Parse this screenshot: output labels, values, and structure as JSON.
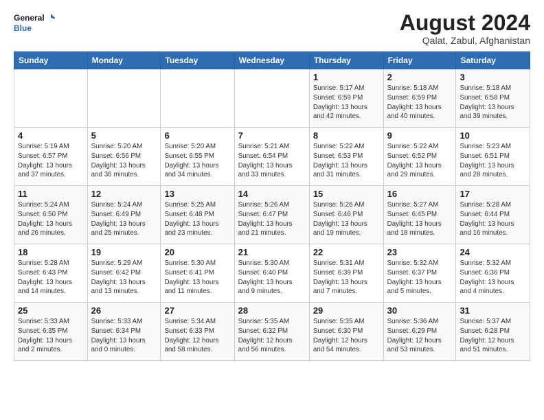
{
  "header": {
    "logo_line1": "General",
    "logo_line2": "Blue",
    "title": "August 2024",
    "subtitle": "Qalat, Zabul, Afghanistan"
  },
  "weekdays": [
    "Sunday",
    "Monday",
    "Tuesday",
    "Wednesday",
    "Thursday",
    "Friday",
    "Saturday"
  ],
  "weeks": [
    [
      {
        "day": "",
        "detail": ""
      },
      {
        "day": "",
        "detail": ""
      },
      {
        "day": "",
        "detail": ""
      },
      {
        "day": "",
        "detail": ""
      },
      {
        "day": "1",
        "detail": "Sunrise: 5:17 AM\nSunset: 6:59 PM\nDaylight: 13 hours\nand 42 minutes."
      },
      {
        "day": "2",
        "detail": "Sunrise: 5:18 AM\nSunset: 6:59 PM\nDaylight: 13 hours\nand 40 minutes."
      },
      {
        "day": "3",
        "detail": "Sunrise: 5:18 AM\nSunset: 6:58 PM\nDaylight: 13 hours\nand 39 minutes."
      }
    ],
    [
      {
        "day": "4",
        "detail": "Sunrise: 5:19 AM\nSunset: 6:57 PM\nDaylight: 13 hours\nand 37 minutes."
      },
      {
        "day": "5",
        "detail": "Sunrise: 5:20 AM\nSunset: 6:56 PM\nDaylight: 13 hours\nand 36 minutes."
      },
      {
        "day": "6",
        "detail": "Sunrise: 5:20 AM\nSunset: 6:55 PM\nDaylight: 13 hours\nand 34 minutes."
      },
      {
        "day": "7",
        "detail": "Sunrise: 5:21 AM\nSunset: 6:54 PM\nDaylight: 13 hours\nand 33 minutes."
      },
      {
        "day": "8",
        "detail": "Sunrise: 5:22 AM\nSunset: 6:53 PM\nDaylight: 13 hours\nand 31 minutes."
      },
      {
        "day": "9",
        "detail": "Sunrise: 5:22 AM\nSunset: 6:52 PM\nDaylight: 13 hours\nand 29 minutes."
      },
      {
        "day": "10",
        "detail": "Sunrise: 5:23 AM\nSunset: 6:51 PM\nDaylight: 13 hours\nand 28 minutes."
      }
    ],
    [
      {
        "day": "11",
        "detail": "Sunrise: 5:24 AM\nSunset: 6:50 PM\nDaylight: 13 hours\nand 26 minutes."
      },
      {
        "day": "12",
        "detail": "Sunrise: 5:24 AM\nSunset: 6:49 PM\nDaylight: 13 hours\nand 25 minutes."
      },
      {
        "day": "13",
        "detail": "Sunrise: 5:25 AM\nSunset: 6:48 PM\nDaylight: 13 hours\nand 23 minutes."
      },
      {
        "day": "14",
        "detail": "Sunrise: 5:26 AM\nSunset: 6:47 PM\nDaylight: 13 hours\nand 21 minutes."
      },
      {
        "day": "15",
        "detail": "Sunrise: 5:26 AM\nSunset: 6:46 PM\nDaylight: 13 hours\nand 19 minutes."
      },
      {
        "day": "16",
        "detail": "Sunrise: 5:27 AM\nSunset: 6:45 PM\nDaylight: 13 hours\nand 18 minutes."
      },
      {
        "day": "17",
        "detail": "Sunrise: 5:28 AM\nSunset: 6:44 PM\nDaylight: 13 hours\nand 16 minutes."
      }
    ],
    [
      {
        "day": "18",
        "detail": "Sunrise: 5:28 AM\nSunset: 6:43 PM\nDaylight: 13 hours\nand 14 minutes."
      },
      {
        "day": "19",
        "detail": "Sunrise: 5:29 AM\nSunset: 6:42 PM\nDaylight: 13 hours\nand 13 minutes."
      },
      {
        "day": "20",
        "detail": "Sunrise: 5:30 AM\nSunset: 6:41 PM\nDaylight: 13 hours\nand 11 minutes."
      },
      {
        "day": "21",
        "detail": "Sunrise: 5:30 AM\nSunset: 6:40 PM\nDaylight: 13 hours\nand 9 minutes."
      },
      {
        "day": "22",
        "detail": "Sunrise: 5:31 AM\nSunset: 6:39 PM\nDaylight: 13 hours\nand 7 minutes."
      },
      {
        "day": "23",
        "detail": "Sunrise: 5:32 AM\nSunset: 6:37 PM\nDaylight: 13 hours\nand 5 minutes."
      },
      {
        "day": "24",
        "detail": "Sunrise: 5:32 AM\nSunset: 6:36 PM\nDaylight: 13 hours\nand 4 minutes."
      }
    ],
    [
      {
        "day": "25",
        "detail": "Sunrise: 5:33 AM\nSunset: 6:35 PM\nDaylight: 13 hours\nand 2 minutes."
      },
      {
        "day": "26",
        "detail": "Sunrise: 5:33 AM\nSunset: 6:34 PM\nDaylight: 13 hours\nand 0 minutes."
      },
      {
        "day": "27",
        "detail": "Sunrise: 5:34 AM\nSunset: 6:33 PM\nDaylight: 12 hours\nand 58 minutes."
      },
      {
        "day": "28",
        "detail": "Sunrise: 5:35 AM\nSunset: 6:32 PM\nDaylight: 12 hours\nand 56 minutes."
      },
      {
        "day": "29",
        "detail": "Sunrise: 5:35 AM\nSunset: 6:30 PM\nDaylight: 12 hours\nand 54 minutes."
      },
      {
        "day": "30",
        "detail": "Sunrise: 5:36 AM\nSunset: 6:29 PM\nDaylight: 12 hours\nand 53 minutes."
      },
      {
        "day": "31",
        "detail": "Sunrise: 5:37 AM\nSunset: 6:28 PM\nDaylight: 12 hours\nand 51 minutes."
      }
    ]
  ]
}
